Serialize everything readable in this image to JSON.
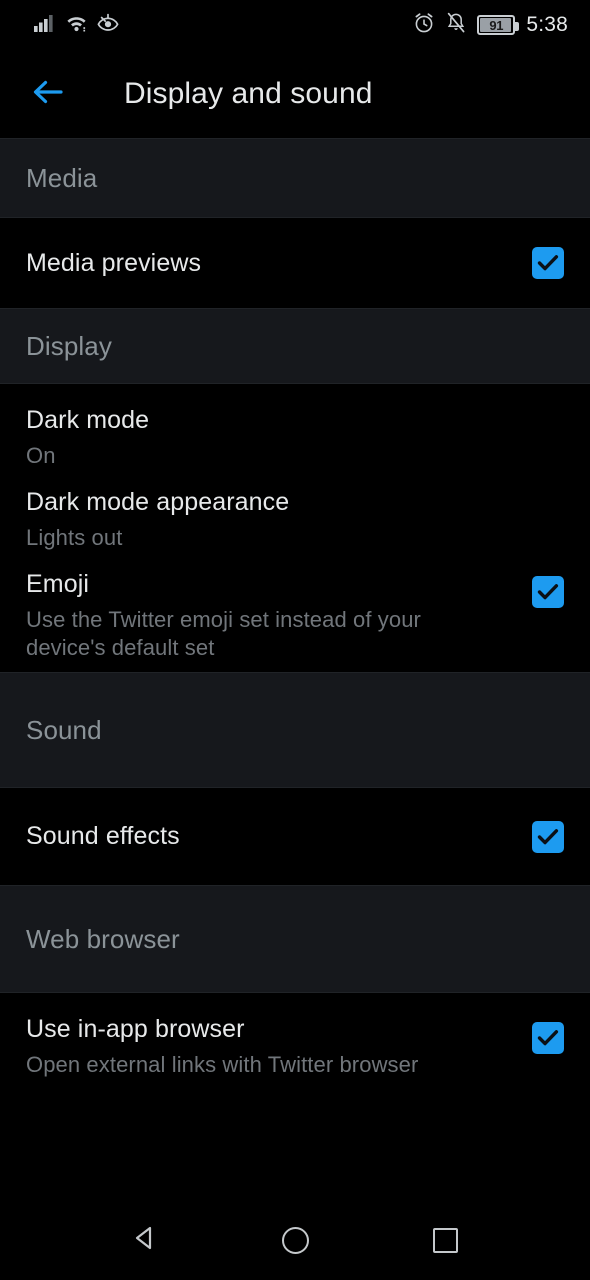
{
  "statusbar": {
    "icons_left": [
      "signal-bars-icon",
      "wifi-icon",
      "eye-comfort-icon"
    ],
    "icons_right": [
      "alarm-clock-icon",
      "notifications-muted-icon"
    ],
    "battery_percent": "91",
    "time": "5:38"
  },
  "appbar": {
    "back_icon": "back-arrow-icon",
    "title": "Display and sound",
    "accent_color": "#1d9bf0"
  },
  "sections": [
    {
      "header": "Media",
      "rows": [
        {
          "title": "Media previews",
          "subtitle": "",
          "checkbox": true
        }
      ]
    },
    {
      "header": "Display",
      "rows": [
        {
          "title": "Dark mode",
          "subtitle": "On",
          "checkbox": false
        },
        {
          "title": "Dark mode appearance",
          "subtitle": "Lights out",
          "checkbox": false
        },
        {
          "title": "Emoji",
          "subtitle": "Use the Twitter emoji set instead of your device's default set",
          "checkbox": true
        }
      ]
    },
    {
      "header": "Sound",
      "rows": [
        {
          "title": "Sound effects",
          "subtitle": "",
          "checkbox": true
        }
      ]
    },
    {
      "header": "Web browser",
      "rows": [
        {
          "title": "Use in-app browser",
          "subtitle": "Open external links with Twitter browser",
          "checkbox": true
        }
      ]
    }
  ],
  "navbar": {
    "back": "nav-back-triangle-icon",
    "home": "nav-home-circle-icon",
    "recents": "nav-recents-square-icon"
  },
  "colors": {
    "background": "#000000",
    "section_header_bg": "#16181c",
    "accent": "#1d9bf0",
    "primary_text": "#e7e9ea",
    "secondary_text": "#71767b",
    "header_text": "#8b9398"
  }
}
